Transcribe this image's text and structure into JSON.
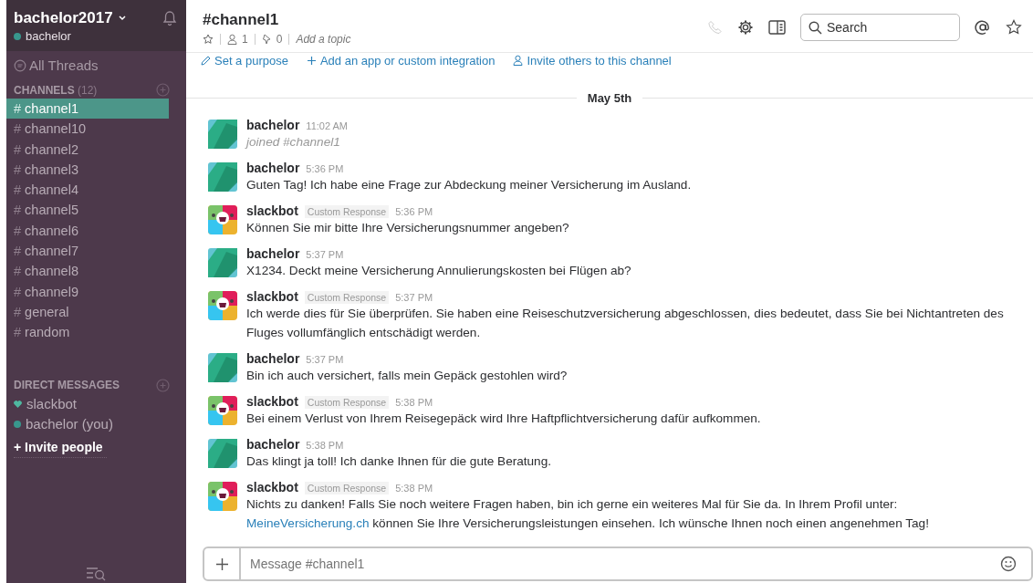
{
  "team": {
    "name": "bachelor2017",
    "user": "bachelor"
  },
  "sidebar": {
    "all_threads": "All Threads",
    "channels_label": "CHANNELS",
    "channels_count": "(12)",
    "channels": [
      {
        "hash": "#",
        "name": "channel1",
        "selected": true
      },
      {
        "hash": "#",
        "name": "channel10",
        "selected": false
      },
      {
        "hash": "#",
        "name": "channel2",
        "selected": false
      },
      {
        "hash": "#",
        "name": "channel3",
        "selected": false
      },
      {
        "hash": "#",
        "name": "channel4",
        "selected": false
      },
      {
        "hash": "#",
        "name": "channel5",
        "selected": false
      },
      {
        "hash": "#",
        "name": "channel6",
        "selected": false
      },
      {
        "hash": "#",
        "name": "channel7",
        "selected": false
      },
      {
        "hash": "#",
        "name": "channel8",
        "selected": false
      },
      {
        "hash": "#",
        "name": "channel9",
        "selected": false
      },
      {
        "hash": "#",
        "name": "general",
        "selected": false
      },
      {
        "hash": "#",
        "name": "random",
        "selected": false
      }
    ],
    "dm_label": "DIRECT MESSAGES",
    "direct_messages": [
      {
        "name": "slackbot",
        "kind": "bot"
      },
      {
        "name": "bachelor (you)",
        "kind": "user"
      }
    ],
    "invite": "+ Invite people"
  },
  "channel": {
    "title": "#channel1",
    "members": "1",
    "pins": "0",
    "topic_placeholder": "Add a topic"
  },
  "search": {
    "placeholder": "Search"
  },
  "actions": [
    "Set a purpose",
    "Add an app or custom integration",
    "Invite others to this channel"
  ],
  "date_divider": "May 5th",
  "messages": [
    {
      "author": "bachelor",
      "kind": "user",
      "time": "11:02 AM",
      "join": true,
      "parts": [
        {
          "kind": "text",
          "text": "joined #channel1"
        }
      ]
    },
    {
      "author": "bachelor",
      "kind": "user",
      "time": "5:36 PM",
      "join": false,
      "parts": [
        {
          "kind": "text",
          "text": "Guten Tag! Ich habe eine Frage zur Abdeckung meiner Versicherung im Ausland."
        }
      ]
    },
    {
      "author": "slackbot",
      "kind": "bot",
      "badge": "Custom Response",
      "time": "5:36 PM",
      "join": false,
      "parts": [
        {
          "kind": "text",
          "text": "Können Sie mir bitte Ihre Versicherungsnummer angeben?"
        }
      ]
    },
    {
      "author": "bachelor",
      "kind": "user",
      "time": "5:37 PM",
      "join": false,
      "parts": [
        {
          "kind": "text",
          "text": "X1234. Deckt meine Versicherung Annulierungskosten bei Flügen ab?"
        }
      ]
    },
    {
      "author": "slackbot",
      "kind": "bot",
      "badge": "Custom Response",
      "time": "5:37 PM",
      "join": false,
      "parts": [
        {
          "kind": "text",
          "text": "Ich werde dies für Sie überprüfen. Sie haben eine Reiseschutzversicherung abgeschlossen, dies bedeutet, dass Sie bei Nichtantreten des Fluges vollumfänglich entschädigt werden."
        }
      ]
    },
    {
      "author": "bachelor",
      "kind": "user",
      "time": "5:37 PM",
      "join": false,
      "parts": [
        {
          "kind": "text",
          "text": "Bin ich auch versichert, falls mein Gepäck gestohlen wird?"
        }
      ]
    },
    {
      "author": "slackbot",
      "kind": "bot",
      "badge": "Custom Response",
      "time": "5:38 PM",
      "join": false,
      "parts": [
        {
          "kind": "text",
          "text": "Bei einem Verlust von Ihrem Reisegepäck wird Ihre Haftpflichtversicherung dafür aufkommen."
        }
      ]
    },
    {
      "author": "bachelor",
      "kind": "user",
      "time": "5:38 PM",
      "join": false,
      "parts": [
        {
          "kind": "text",
          "text": "Das klingt ja toll! Ich danke Ihnen für die gute Beratung."
        }
      ]
    },
    {
      "author": "slackbot",
      "kind": "bot",
      "badge": "Custom Response",
      "time": "5:38 PM",
      "join": false,
      "parts": [
        {
          "kind": "text",
          "text": "Nichts zu danken! Falls Sie noch weitere Fragen haben, bin ich gerne ein weiteres Mal für Sie da. In Ihrem Profil unter: "
        },
        {
          "kind": "link",
          "text": "MeineVersicherung.ch"
        },
        {
          "kind": "text",
          "text": " können Sie Ihre Versicherungsleistungen einsehen. Ich wünsche Ihnen noch einen angenehmen Tag!"
        }
      ]
    }
  ],
  "composer": {
    "placeholder": "Message #channel1"
  }
}
